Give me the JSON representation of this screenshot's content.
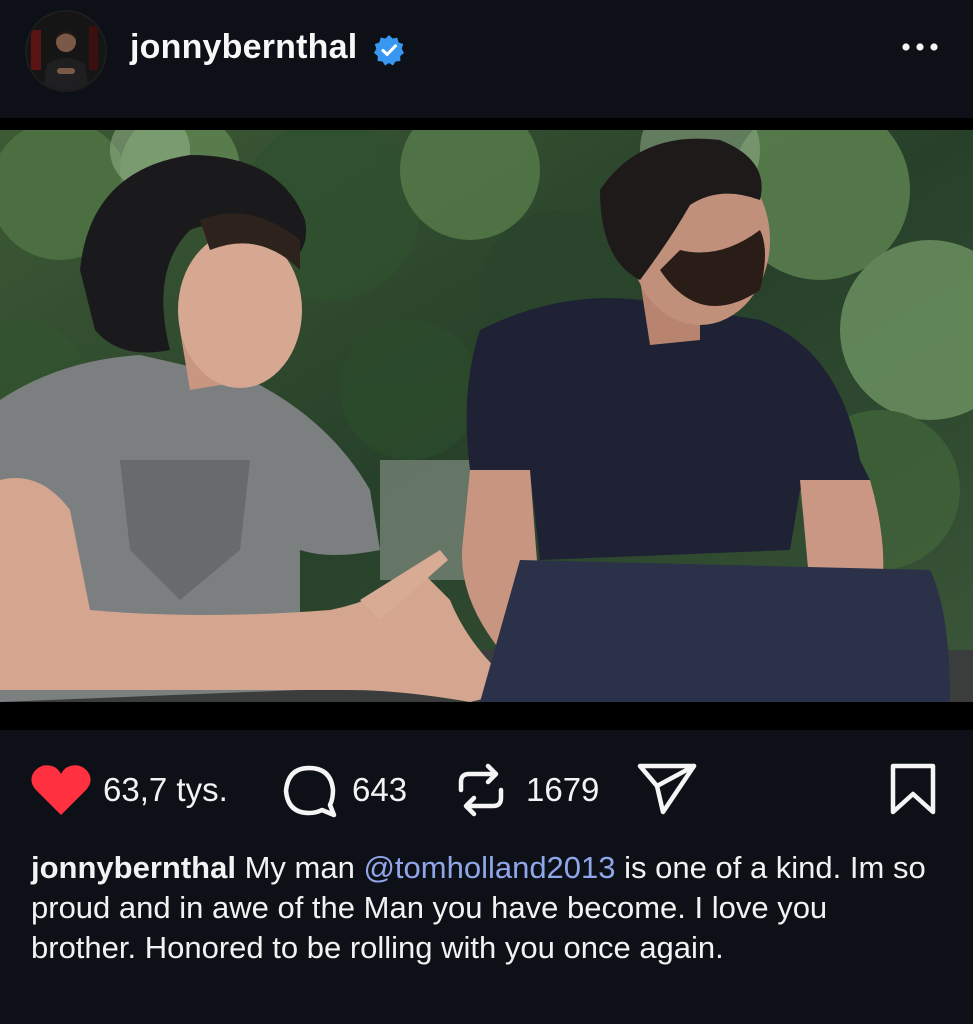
{
  "post": {
    "username": "jonnybernthal",
    "verified": true,
    "more_icon": "more-horizontal-icon"
  },
  "actions": {
    "likes": "63,7 tys.",
    "comments": "643",
    "reposts": "1679",
    "like_color": "#ff3040",
    "icons": [
      "heart-icon",
      "comment-icon",
      "repost-icon",
      "share-icon",
      "bookmark-icon"
    ]
  },
  "caption": {
    "username": "jonnybernthal",
    "text_before": "My man ",
    "mention": "@tomholland2013",
    "text_after": " is one of a kind. Im so proud and in awe of the Man you have become. I love you brother. Honored to be rolling with you once again.",
    "mention_color": "#8fa6ea"
  }
}
